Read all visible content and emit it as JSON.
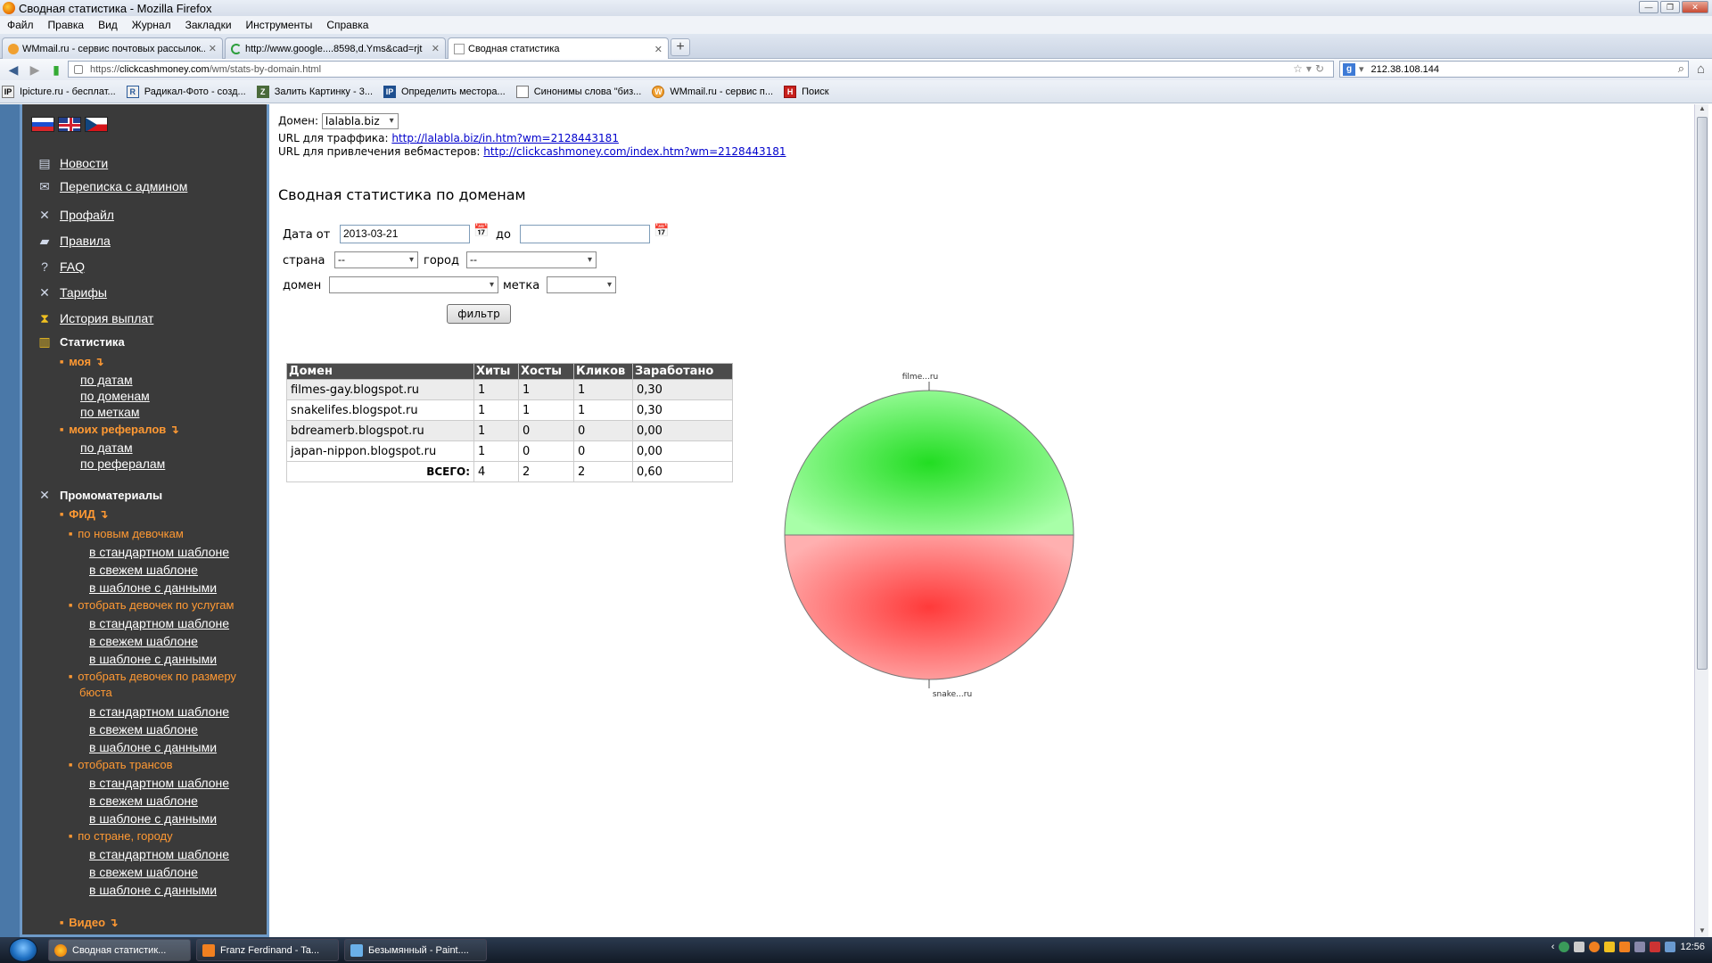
{
  "browser": {
    "window_title": "Сводная статистика - Mozilla Firefox",
    "menu": [
      "Файл",
      "Правка",
      "Вид",
      "Журнал",
      "Закладки",
      "Инструменты",
      "Справка"
    ],
    "tabs": [
      {
        "label": "WMmail.ru - сервис почтовых рассылок...",
        "active": false
      },
      {
        "label": "http://www.google....8598,d.Yms&cad=rjt",
        "active": false
      },
      {
        "label": "Сводная статистика",
        "active": true
      }
    ],
    "url_prefix": "https://",
    "url_host": "clickcashmoney.com",
    "url_path": "/wm/stats-by-domain.html",
    "search_value": "212.38.108.144",
    "bookmarks": [
      {
        "label": "Ipicture.ru - бесплат...",
        "icon": "IP"
      },
      {
        "label": "Радикал-Фото - созд...",
        "icon": "R"
      },
      {
        "label": "Залить Картинку - 3...",
        "icon": "Z"
      },
      {
        "label": "Определить местора...",
        "icon": "IP"
      },
      {
        "label": "Синонимы слова \"биз...",
        "icon": ""
      },
      {
        "label": "WMmail.ru - сервис п...",
        "icon": "W"
      },
      {
        "label": "Поиск",
        "icon": "H"
      }
    ]
  },
  "sidebar": {
    "nav": [
      {
        "label": "Новости",
        "icon": "news-icon"
      },
      {
        "label": "Переписка с админом",
        "icon": "mail-icon"
      },
      {
        "label": "Профайл",
        "icon": "tools-icon"
      },
      {
        "label": "Правила",
        "icon": "book-icon"
      },
      {
        "label": "FAQ",
        "icon": "faq-icon"
      },
      {
        "label": "Тарифы",
        "icon": "tools-icon"
      },
      {
        "label": "История выплат",
        "icon": "hourglass-icon"
      }
    ],
    "stats": {
      "title": "Статистика",
      "my": "моя ↴",
      "my_items": [
        "по датам",
        "по доменам",
        "по меткам"
      ],
      "refs": "моих рефералов ↴",
      "refs_items": [
        "по датам",
        "по рефералам"
      ]
    },
    "promo": {
      "title": "Промоматериалы",
      "feed": "ФИД ↴",
      "groups": [
        {
          "label": "по новым девочкам",
          "items": [
            "в стандартном шаблоне",
            "в свежем шаблоне",
            "в шаблоне с данными"
          ]
        },
        {
          "label": "отобрать девочек по услугам",
          "items": [
            "в стандартном шаблоне",
            "в свежем шаблоне",
            "в шаблоне с данными"
          ]
        },
        {
          "label": "отобрать девочек по размеру",
          "label2": "бюста",
          "items": [
            "в стандартном шаблоне",
            "в свежем шаблоне",
            "в шаблоне с данными"
          ]
        },
        {
          "label": "отобрать трансов",
          "items": [
            "в стандартном шаблоне",
            "в свежем шаблоне",
            "в шаблоне с данными"
          ]
        },
        {
          "label": "по стране, городу",
          "items": [
            "в стандартном шаблоне",
            "в свежем шаблоне",
            "в шаблоне с данными"
          ]
        }
      ],
      "video": "Видео ↴"
    }
  },
  "content": {
    "domain_label": "Домен:",
    "domain_value": "lalabla.biz",
    "traffic_url_label": "URL для траффика:",
    "traffic_url": "http://lalabla.biz/in.htm?wm=2128443181",
    "webmaster_url_label": "URL для привлечения вебмастеров:",
    "webmaster_url": "http://clickcashmoney.com/index.htm?wm=2128443181",
    "page_title": "Сводная статистика по доменам",
    "filter": {
      "date_from_label": "Дата от",
      "date_from": "2013-03-21",
      "date_to_label": "до",
      "date_to": "",
      "country_label": "страна",
      "country_value": "--",
      "city_label": "город",
      "city_value": "--",
      "domain_label": "домен",
      "domain_value": "",
      "tag_label": "метка",
      "tag_value": "",
      "button": "фильтр"
    },
    "table": {
      "headers": [
        "Домен",
        "Хиты",
        "Хосты",
        "Кликов",
        "Заработано"
      ],
      "rows": [
        [
          "filmes-gay.blogspot.ru",
          "1",
          "1",
          "1",
          "0,30"
        ],
        [
          "snakelifes.blogspot.ru",
          "1",
          "1",
          "1",
          "0,30"
        ],
        [
          "bdreamerb.blogspot.ru",
          "1",
          "0",
          "0",
          "0,00"
        ],
        [
          "japan-nippon.blogspot.ru",
          "1",
          "0",
          "0",
          "0,00"
        ]
      ],
      "total_label": "ВСЕГО:",
      "total": [
        "4",
        "2",
        "2",
        "0,60"
      ]
    }
  },
  "chart_data": {
    "type": "pie",
    "labels": [
      "filme...ru",
      "snake...ru"
    ],
    "values": [
      0.3,
      0.3
    ],
    "colors": [
      "#33ee33",
      "#ff4444"
    ]
  },
  "taskbar": {
    "items": [
      {
        "label": "Сводная статистик...",
        "active": true
      },
      {
        "label": "Franz Ferdinand - Ta...",
        "active": false
      },
      {
        "label": "Безымянный - Paint....",
        "active": false
      }
    ],
    "clock": "12:56"
  }
}
